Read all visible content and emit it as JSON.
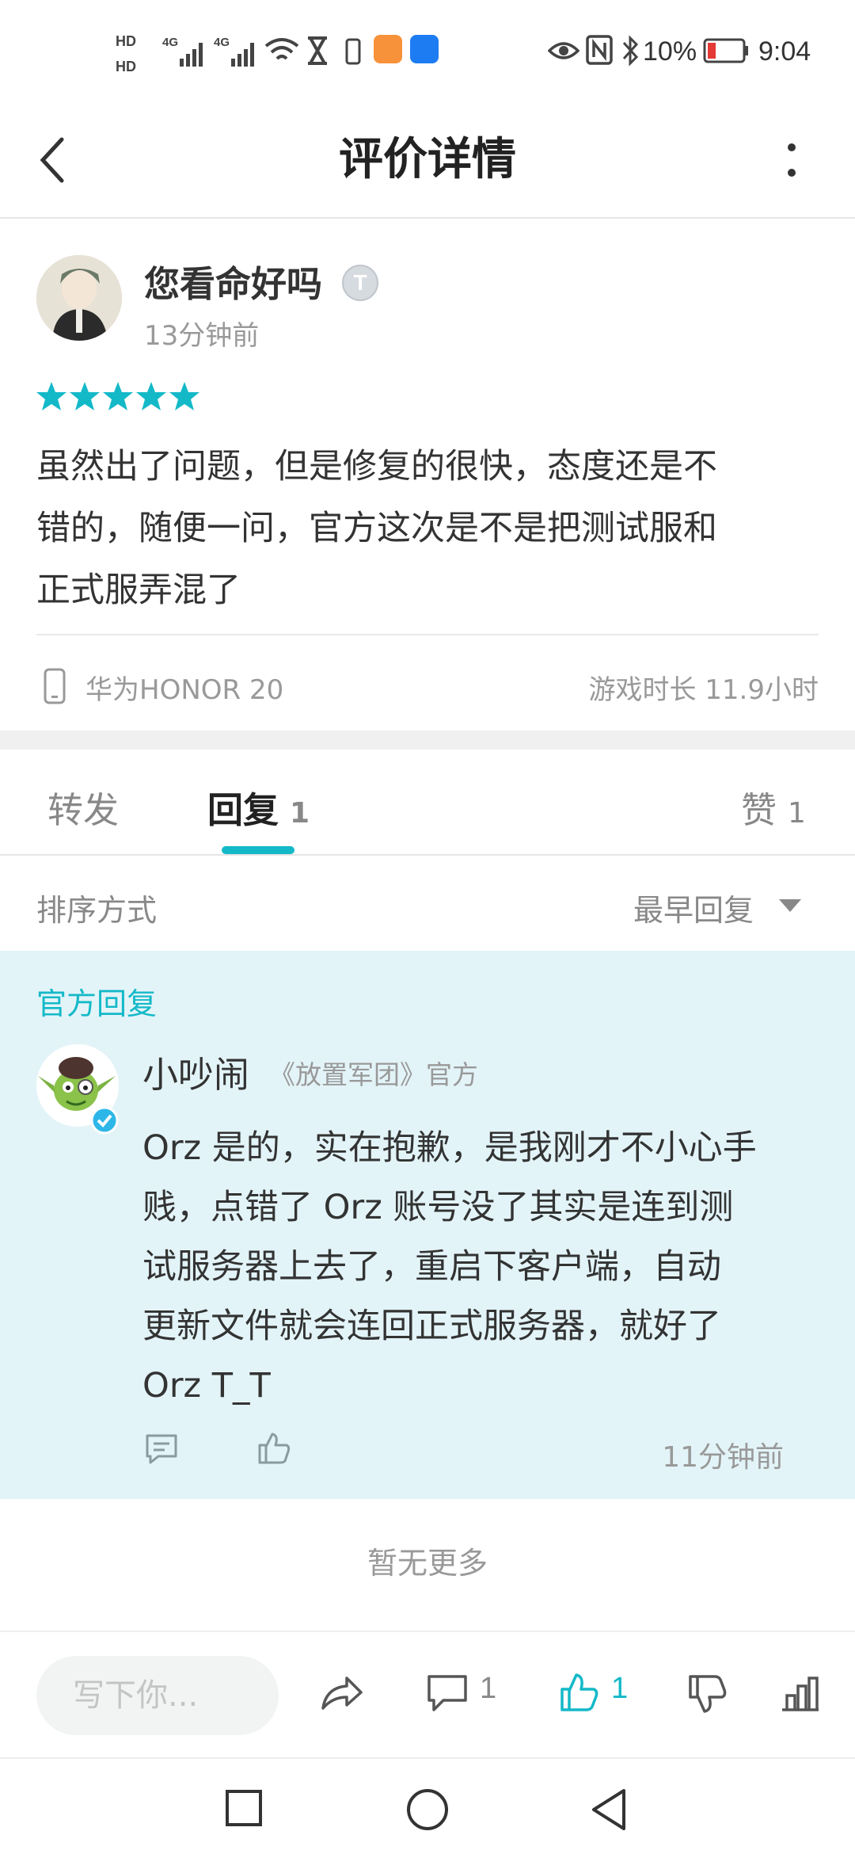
{
  "status_bar": {
    "battery_percent": "10%",
    "time": "9:04",
    "network_1": "4G",
    "network_2": "4G"
  },
  "header": {
    "title": "评价详情"
  },
  "review": {
    "author": "您看命好吗",
    "badge": "T",
    "time_ago": "13分钟前",
    "stars": 5,
    "body_lines": [
      "虽然出了问题，但是修复的很快，态度还是不",
      "错的，随便一问，官方这次是不是把测试服和",
      "正式服弄混了"
    ],
    "device": "华为HONOR 20",
    "playtime": "游戏时长 11.9小时"
  },
  "tabs": {
    "forward": "转发",
    "reply": "回复",
    "reply_count": "1",
    "like": "赞",
    "like_count": "1"
  },
  "sort": {
    "label": "排序方式",
    "value": "最早回复"
  },
  "official_reply": {
    "section_label": "官方回复",
    "name": "小吵闹",
    "game_tag": "《放置军团》官方",
    "body_lines": [
      "Orz 是的，实在抱歉，是我刚才不小心手",
      "贱，点错了 Orz 账号没了其实是连到测",
      "试服务器上去了，重启下客户端，自动",
      "更新文件就会连回正式服务器，就好了",
      "Orz T_T"
    ],
    "time_ago": "11分钟前"
  },
  "no_more": "暂无更多",
  "bottom_bar": {
    "input_placeholder": "写下你...",
    "comment_count": "1",
    "like_count": "1"
  },
  "colors": {
    "accent": "#14b9c8",
    "official_bg": "#e3f4f8"
  }
}
